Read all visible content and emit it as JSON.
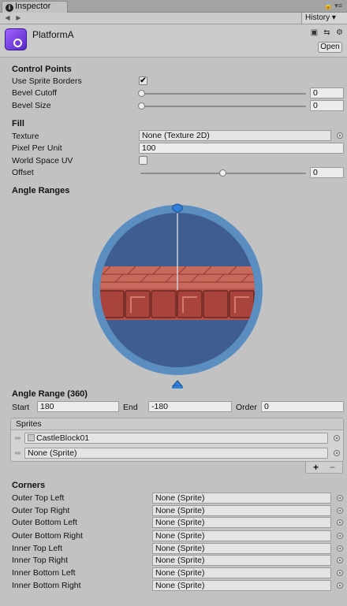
{
  "window": {
    "tab_label": "Inspector",
    "history_label": "History",
    "controls_glyph": "🔒 ▾≡"
  },
  "nav": {
    "back_glyph": "◀",
    "forward_glyph": "▶"
  },
  "asset": {
    "name": "PlatformA",
    "open_label": "Open",
    "icon_color": "#7b47e6"
  },
  "control_points": {
    "title": "Control Points",
    "use_sprite_borders": {
      "label": "Use Sprite Borders",
      "checked": true,
      "glyph": "✔"
    },
    "bevel_cutoff": {
      "label": "Bevel Cutoff",
      "value": "0",
      "slider": 0
    },
    "bevel_size": {
      "label": "Bevel Size",
      "value": "0",
      "slider": 0
    }
  },
  "fill": {
    "title": "Fill",
    "texture": {
      "label": "Texture",
      "value": "None (Texture 2D)"
    },
    "pixel_per_unit": {
      "label": "Pixel Per Unit",
      "value": "100"
    },
    "world_space_uv": {
      "label": "World Space UV",
      "checked": false
    },
    "offset": {
      "label": "Offset",
      "value": "0",
      "slider": 0.5
    }
  },
  "angle_ranges": {
    "title": "Angle Ranges",
    "colors": {
      "ring": "#5b8ec0",
      "disc": "#3f5d8e",
      "brick": "#b9524a",
      "handle": "#2e7fd8"
    }
  },
  "angle_range": {
    "title": "Angle Range (360)",
    "start_label": "Start",
    "start_value": "180",
    "end_label": "End",
    "end_value": "-180",
    "order_label": "Order",
    "order_value": "0"
  },
  "sprites": {
    "header": "Sprites",
    "items": [
      {
        "value": "CastleBlock01",
        "has_thumb": true
      },
      {
        "value": "None (Sprite)",
        "has_thumb": false
      }
    ],
    "add_label": "+",
    "remove_label": "−",
    "drag_glyph": "═"
  },
  "corners": {
    "title": "Corners",
    "rows": [
      {
        "label": "Outer Top Left",
        "value": "None (Sprite)"
      },
      {
        "label": "Outer Top Right",
        "value": "None (Sprite)"
      },
      {
        "label": "Outer Bottom Left",
        "value": "None (Sprite)"
      },
      {
        "label": "Outer Bottom Right",
        "value": "None (Sprite)"
      },
      {
        "label": "Inner Top Left",
        "value": "None (Sprite)"
      },
      {
        "label": "Inner Top Right",
        "value": "None (Sprite)"
      },
      {
        "label": "Inner Bottom Left",
        "value": "None (Sprite)"
      },
      {
        "label": "Inner Bottom Right",
        "value": "None (Sprite)"
      }
    ]
  }
}
